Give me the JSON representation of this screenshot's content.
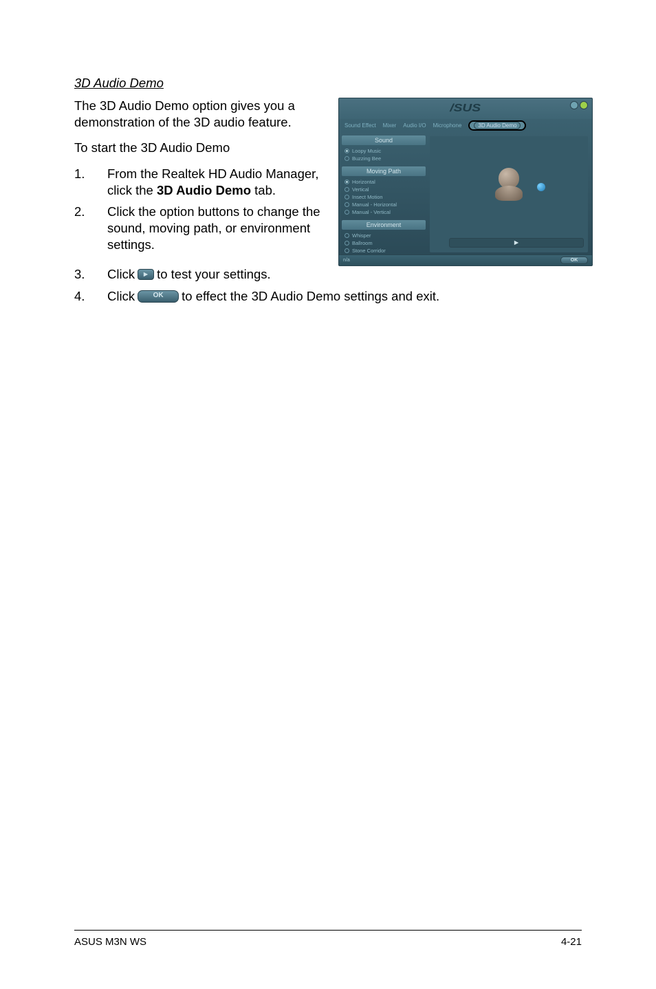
{
  "heading": "3D Audio Demo",
  "intro": "The 3D Audio Demo option gives you a demonstration of the 3D audio feature.",
  "start_label": "To start the 3D Audio Demo",
  "steps": {
    "s1_num": "1.",
    "s1_a": "From the Realtek HD Audio Manager, click the ",
    "s1_bold": "3D Audio Demo",
    "s1_b": " tab.",
    "s2_num": "2.",
    "s2": "Click the option buttons to change the sound, moving path, or environment settings.",
    "s3_num": "3.",
    "s3_a": "Click ",
    "s3_b": " to test your settings.",
    "s4_num": "4.",
    "s4_a": "Click ",
    "s4_b": " to effect the 3D Audio Demo settings and exit."
  },
  "ok_label": "OK",
  "shot": {
    "logo": "/SUS",
    "tabs": {
      "t1": "Sound Effect",
      "t2": "Mixer",
      "t3": "Audio I/O",
      "t4": "Microphone",
      "t5": "3D Audio Demo"
    },
    "sections": {
      "sound": "Sound",
      "moving_path": "Moving Path",
      "environment": "Environment"
    },
    "sound_opts": {
      "o1": "Loopy Music",
      "o2": "Buzzing Bee"
    },
    "path_opts": {
      "o1": "Horizontal",
      "o2": "Vertical",
      "o3": "Insect Motion",
      "o4": "Manual - Horizontal",
      "o5": "Manual - Vertical"
    },
    "env_opts": {
      "o1": "Whisper",
      "o2": "Ballroom",
      "o3": "Stone Corridor"
    },
    "status": "n/a",
    "ok": "OK"
  },
  "footer": {
    "left": "ASUS M3N WS",
    "right": "4-21"
  }
}
